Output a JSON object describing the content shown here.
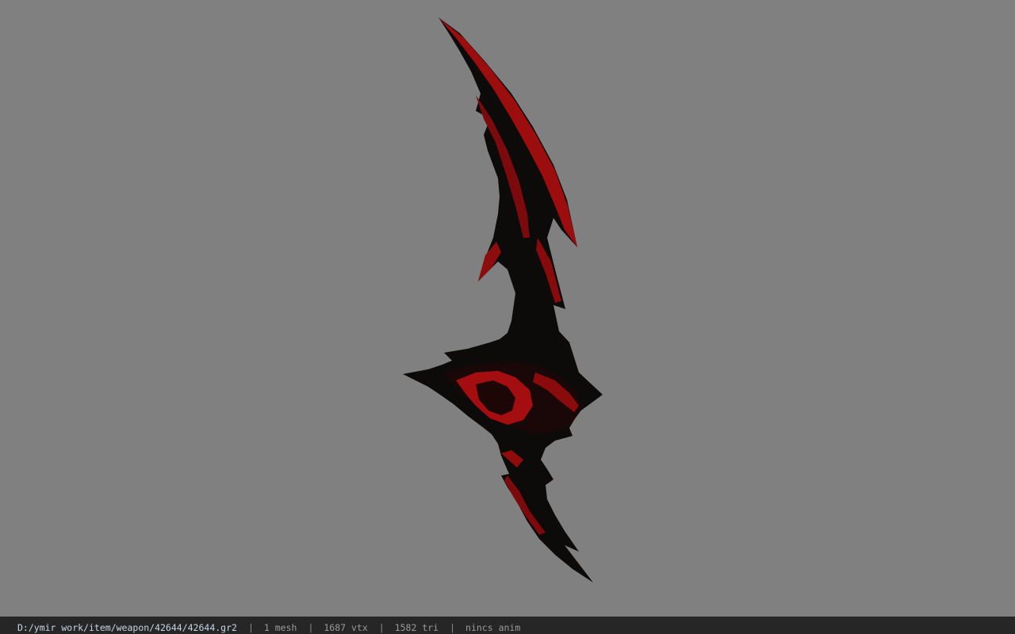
{
  "viewer": {
    "background_color": "#808080",
    "model_colors": {
      "primary": "#0d0a0a",
      "accent": "#b00f10"
    }
  },
  "status": {
    "file_path": "D:/ymir work/item/weapon/42644/42644.gr2",
    "separator": "|",
    "mesh_count": "1 mesh",
    "vertex_count": "1687 vtx",
    "triangle_count": "1582 tri",
    "animation": "nincs anim"
  }
}
